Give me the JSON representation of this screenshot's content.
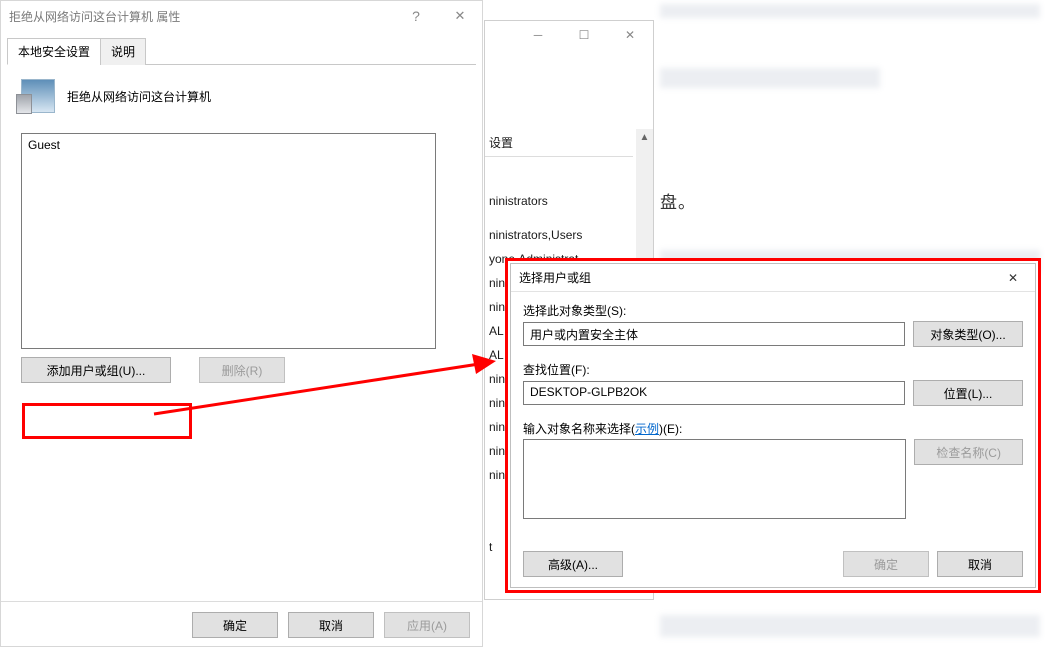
{
  "props": {
    "title": "拒绝从网络访问这台计算机 属性",
    "tab_security": "本地安全设置",
    "tab_explain": "说明",
    "policy_name": "拒绝从网络访问这台计算机",
    "list_item": "Guest",
    "btn_add": "添加用户或组(U)...",
    "btn_del": "删除(R)",
    "btn_ok": "确定",
    "btn_cancel": "取消",
    "btn_apply": "应用(A)"
  },
  "bg": {
    "header": "设置",
    "items": [
      "ninistrators",
      "ninistrators,Users",
      "yone,Administrat...",
      "ninist...",
      "ninist...",
      "AL SE...",
      "AL S...",
      "ninist...",
      "ninist...",
      "ninist...",
      "ninist...",
      "ninist...",
      "t"
    ]
  },
  "right_text": "盘。",
  "sel": {
    "title": "选择用户或组",
    "lbl_objtype": "选择此对象类型(S):",
    "val_objtype": "用户或内置安全主体",
    "btn_objtype": "对象类型(O)...",
    "lbl_loc": "查找位置(F):",
    "val_loc": "DESKTOP-GLPB2OK",
    "btn_loc": "位置(L)...",
    "lbl_names_pre": "输入对象名称来选择(",
    "lbl_names_link": "示例",
    "lbl_names_post": ")(E):",
    "btn_checknames": "检查名称(C)",
    "btn_advanced": "高级(A)...",
    "btn_ok": "确定",
    "btn_cancel": "取消"
  }
}
